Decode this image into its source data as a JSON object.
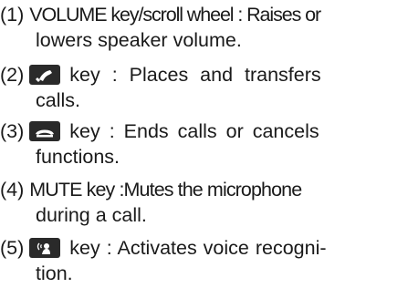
{
  "items": [
    {
      "number": "(1)",
      "line1": "VOLUME key/scroll wheel : Raises or",
      "line2": "lowers speaker volume."
    },
    {
      "number": "(2)",
      "icon": "phone-handset-icon",
      "line1": "key : Places and transfers",
      "line2": "calls."
    },
    {
      "number": "(3)",
      "icon": "hang-up-icon",
      "line1": "key : Ends calls or cancels",
      "line2": "functions."
    },
    {
      "number": "(4)",
      "line1": "MUTE key :Mutes the microphone",
      "line2": "during a call."
    },
    {
      "number": "(5)",
      "icon": "voice-recognition-icon",
      "line1": "key : Activates voice recogni-",
      "line2": "tion."
    }
  ],
  "colors": {
    "text": "#1a1a1a",
    "icon_background": "#2a2a2a",
    "icon_symbol": "#ffffff"
  }
}
